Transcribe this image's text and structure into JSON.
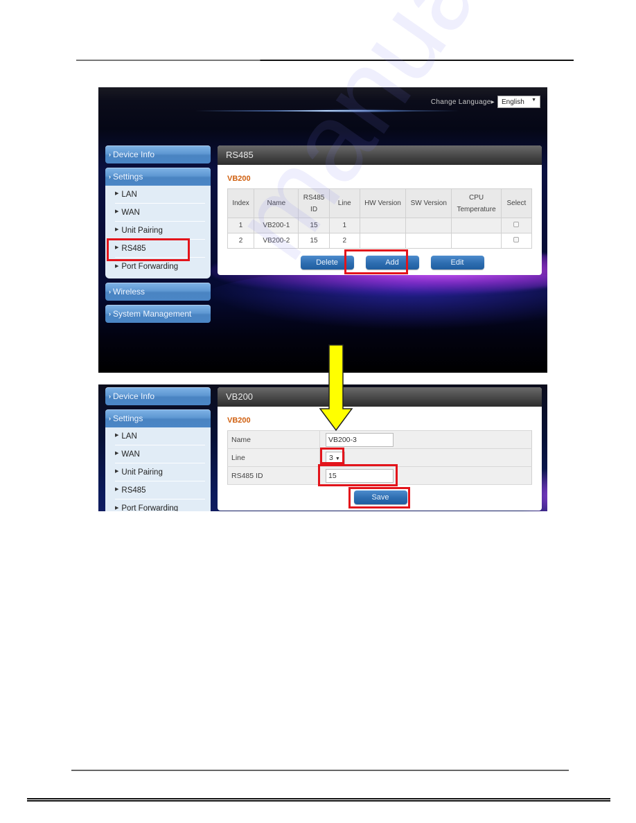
{
  "header": {
    "change_language_label": "Change Language",
    "language_selected": "English"
  },
  "sidebar": {
    "items": [
      {
        "label": "Device Info"
      },
      {
        "label": "Settings",
        "expanded": true,
        "children": [
          "LAN",
          "WAN",
          "Unit Pairing",
          "RS485",
          "Port Forwarding"
        ]
      },
      {
        "label": "Wireless"
      },
      {
        "label": "System Management"
      }
    ],
    "highlighted": "RS485"
  },
  "rs485_panel": {
    "title": "RS485",
    "section": "VB200",
    "columns": [
      "Index",
      "Name",
      "RS485 ID",
      "Line",
      "HW Version",
      "SW Version",
      "CPU Temperature",
      "Select"
    ],
    "rows": [
      {
        "index": "1",
        "name": "VB200-1",
        "rs485_id": "15",
        "line": "1",
        "hw_version": "",
        "sw_version": "",
        "cpu_temp": "",
        "selected": false
      },
      {
        "index": "2",
        "name": "VB200-2",
        "rs485_id": "15",
        "line": "2",
        "hw_version": "",
        "sw_version": "",
        "cpu_temp": "",
        "selected": false
      }
    ],
    "buttons": {
      "delete": "Delete",
      "add": "Add",
      "edit": "Edit"
    },
    "highlighted": "Add"
  },
  "vb200_panel": {
    "title": "VB200",
    "section": "VB200",
    "fields": {
      "name_label": "Name",
      "name_value": "VB200-3",
      "line_label": "Line",
      "line_value": "3",
      "rs485_label": "RS485 ID",
      "rs485_value": "15"
    },
    "save_label": "Save"
  },
  "annotations": {
    "highlight_color": "#e3141b",
    "arrow_color": "#ffff00"
  },
  "watermark": "manualslib"
}
